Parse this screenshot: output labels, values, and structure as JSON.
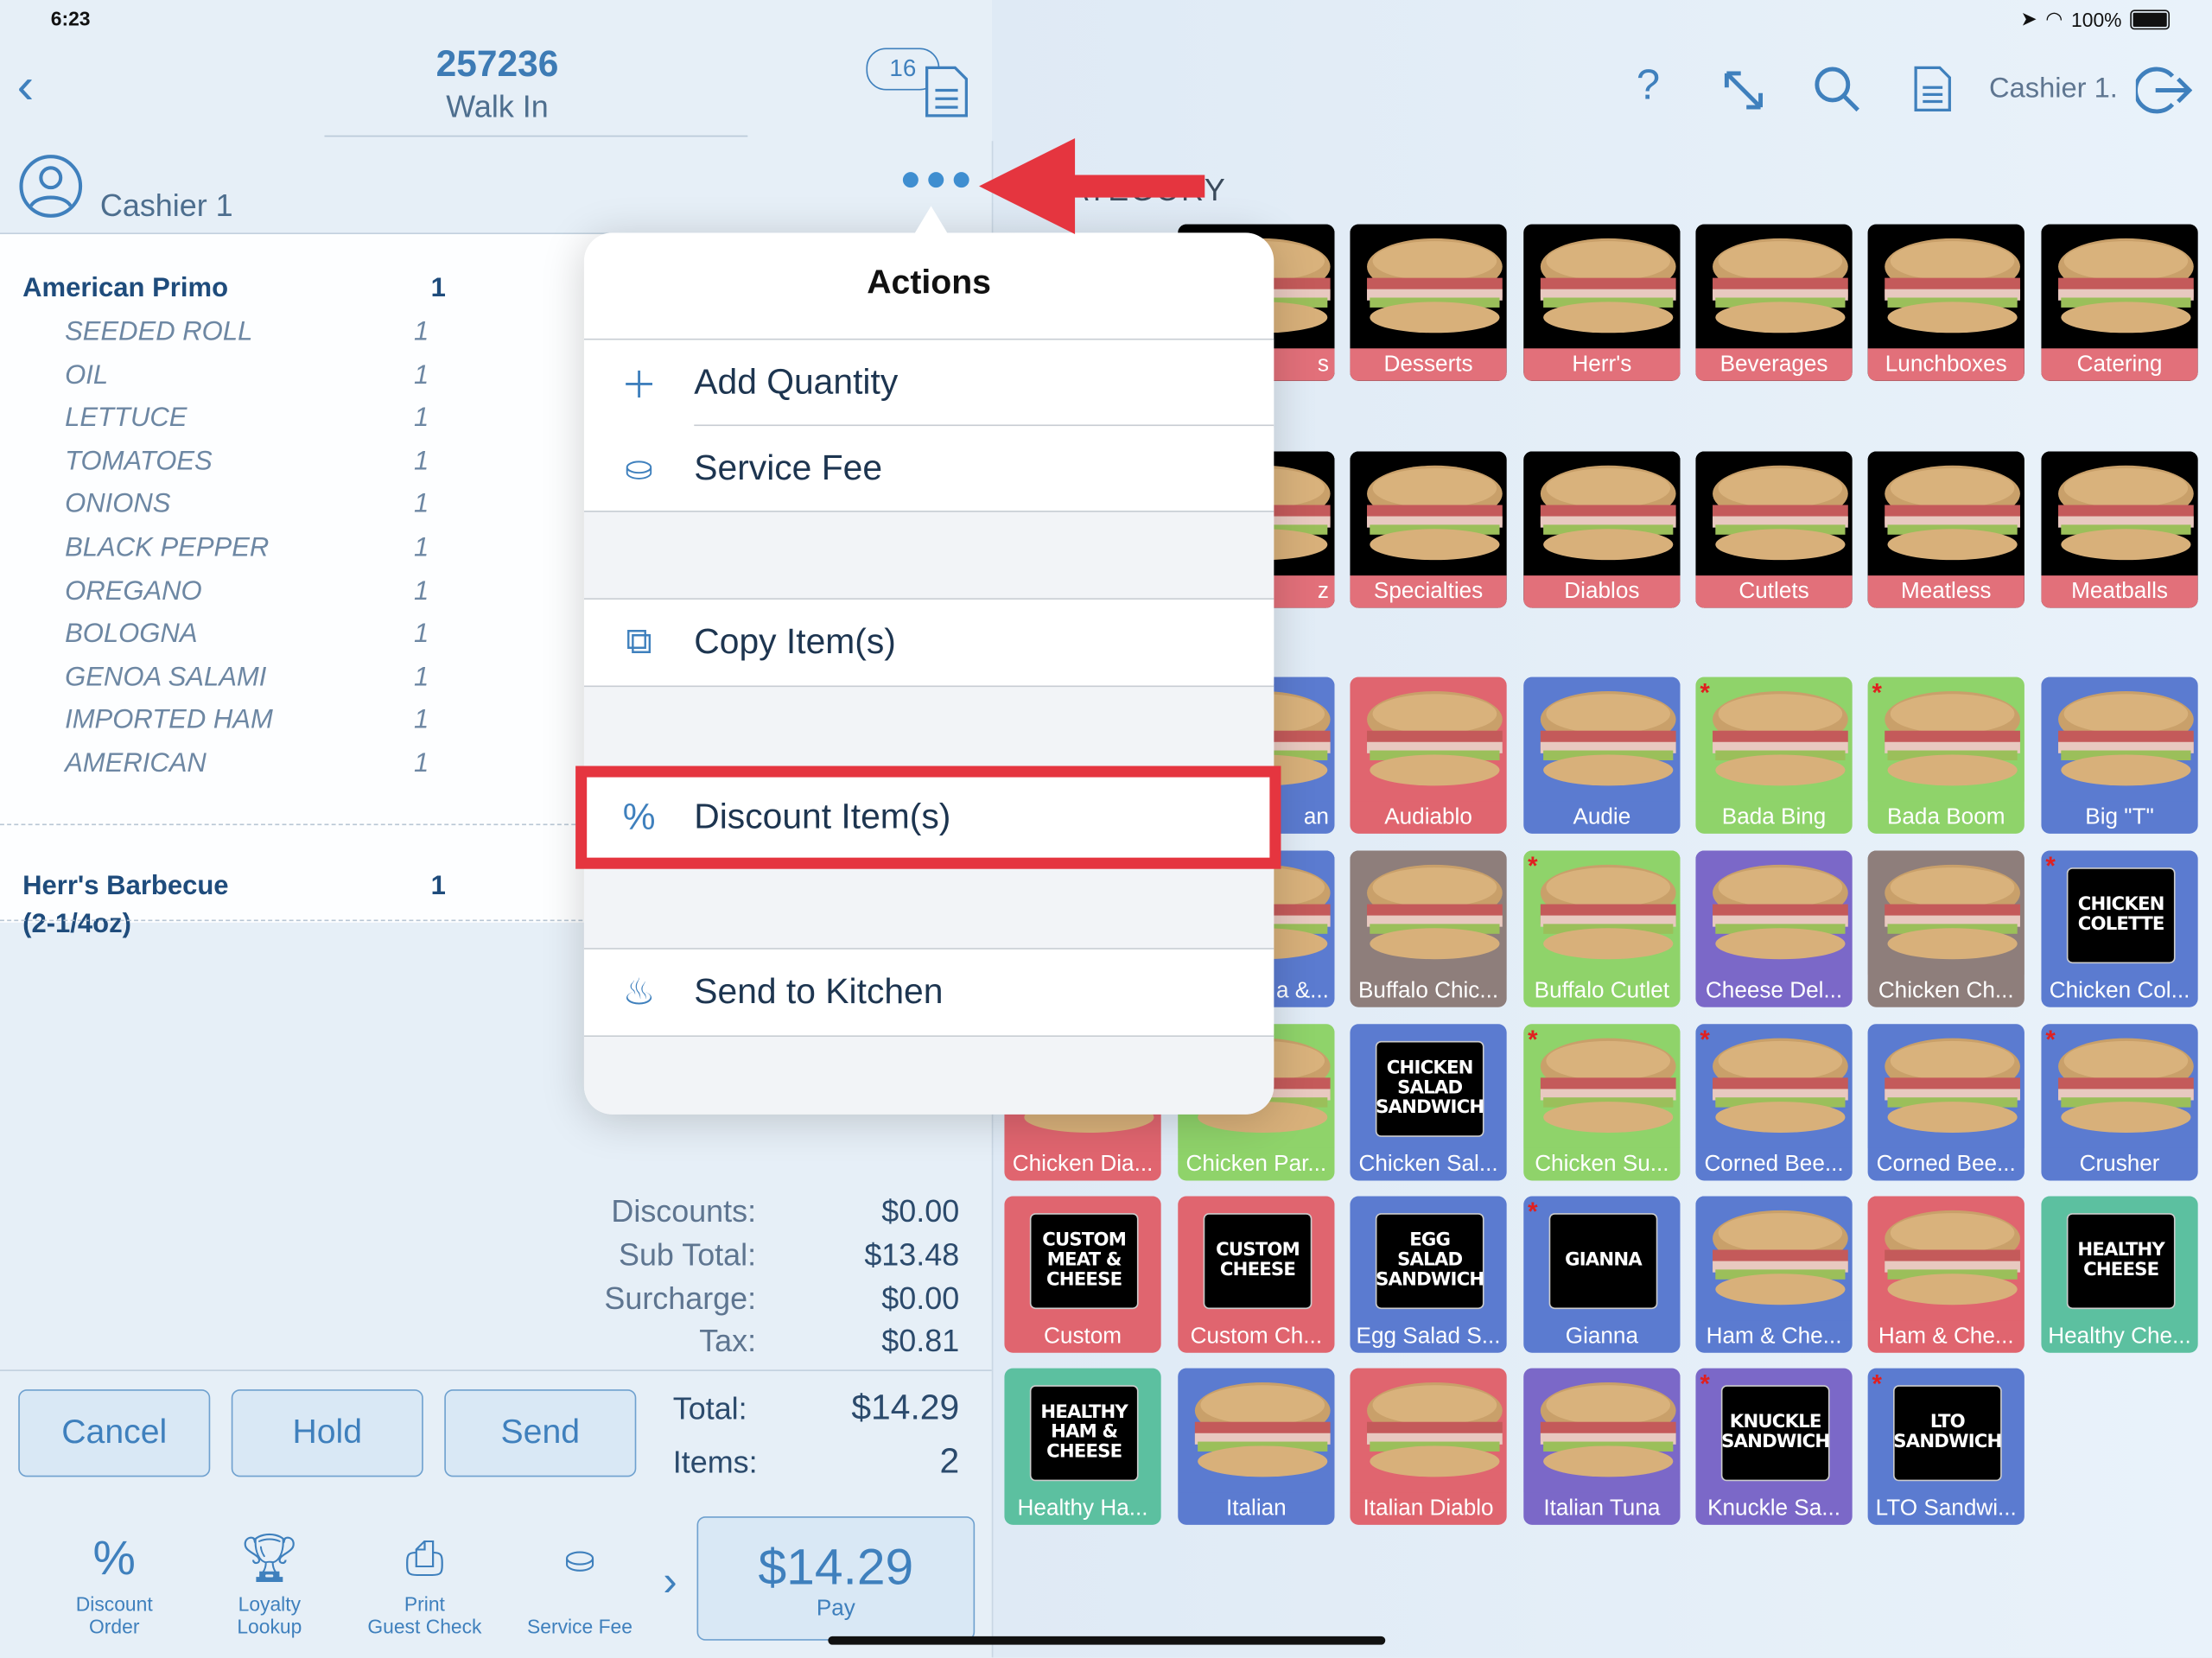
{
  "status_bar": {
    "time": "6:23",
    "battery": "100%"
  },
  "header": {
    "order_number": "257236",
    "order_type": "Walk In",
    "badge_count": "16",
    "cashier": "Cashier 1."
  },
  "cashier_row": {
    "name": "Cashier 1"
  },
  "order": {
    "items": [
      {
        "name": "American Primo",
        "qty": "1",
        "modifiers": [
          {
            "name": "SEEDED ROLL",
            "qty": "1"
          },
          {
            "name": "OIL",
            "qty": "1"
          },
          {
            "name": "LETTUCE",
            "qty": "1"
          },
          {
            "name": "TOMATOES",
            "qty": "1"
          },
          {
            "name": "ONIONS",
            "qty": "1"
          },
          {
            "name": "BLACK PEPPER",
            "qty": "1"
          },
          {
            "name": "OREGANO",
            "qty": "1"
          },
          {
            "name": "BOLOGNA",
            "qty": "1"
          },
          {
            "name": "GENOA SALAMI",
            "qty": "1"
          },
          {
            "name": "IMPORTED HAM",
            "qty": "1"
          },
          {
            "name": "AMERICAN",
            "qty": "1"
          }
        ]
      },
      {
        "name": "Herr's Barbecue",
        "name2": "(2-1/4oz)",
        "qty": "1",
        "modifiers": []
      }
    ]
  },
  "totals": {
    "discounts_label": "Discounts:",
    "discounts": "$0.00",
    "subtotal_label": "Sub Total:",
    "subtotal": "$13.48",
    "surcharge_label": "Surcharge:",
    "surcharge": "$0.00",
    "tax_label": "Tax:",
    "tax": "$0.81",
    "total_label": "Total:",
    "total": "$14.29",
    "items_label": "Items:",
    "items": "2"
  },
  "buttons": {
    "cancel": "Cancel",
    "hold": "Hold",
    "send": "Send"
  },
  "toolbar": {
    "discount_order": "Discount\nOrder",
    "loyalty_lookup": "Loyalty\nLookup",
    "print_guest_check": "Print\nGuest Check",
    "service_fee": "Service Fee",
    "pay_amount": "$14.29",
    "pay_label": "Pay"
  },
  "category_label": "CATEGORY",
  "categories": [
    [
      {
        "label": "",
        "hidden": true
      },
      {
        "label": "s"
      },
      {
        "label": "Desserts"
      },
      {
        "label": "Herr's"
      },
      {
        "label": "Beverages"
      },
      {
        "label": "Lunchboxes"
      },
      {
        "label": "Catering"
      }
    ],
    [
      {
        "label": "",
        "hidden": true
      },
      {
        "label": "z"
      },
      {
        "label": "Specialties"
      },
      {
        "label": "Diablos"
      },
      {
        "label": "Cutlets"
      },
      {
        "label": "Meatless"
      },
      {
        "label": "Meatballs"
      }
    ]
  ],
  "items": [
    [
      {
        "label": "",
        "hidden": true
      },
      {
        "label": "an",
        "color": "#5b7bd0",
        "partial": true
      },
      {
        "label": "Audiablo",
        "color": "#e0656f"
      },
      {
        "label": "Audie",
        "color": "#5b7bd0"
      },
      {
        "label": "Bada Bing",
        "color": "#8fd36a",
        "star": true
      },
      {
        "label": "Bada Boom",
        "color": "#8fd36a",
        "star": true
      },
      {
        "label": "Big \"T\"",
        "color": "#5b7bd0"
      }
    ],
    [
      {
        "label": "",
        "hidden": true
      },
      {
        "label": "a &...",
        "color": "#5b7bd0",
        "partial": true
      },
      {
        "label": "Buffalo Chic...",
        "color": "#8e7e7b"
      },
      {
        "label": "Buffalo Cutlet",
        "color": "#8fd36a",
        "star": true
      },
      {
        "label": "Cheese Del...",
        "color": "#7b68c8"
      },
      {
        "label": "Chicken Ch...",
        "color": "#8e7e7b"
      },
      {
        "label": "Chicken Col...",
        "color": "#5b7bd0",
        "star": true,
        "logo": "CHICKEN\nCOLETTE"
      }
    ],
    [
      {
        "label": "Chicken Dia...",
        "color": "#e0656f"
      },
      {
        "label": "Chicken Par...",
        "color": "#8fd36a"
      },
      {
        "label": "Chicken Sal...",
        "color": "#5b7bd0",
        "logo": "CHICKEN\nSALAD\nSANDWICH"
      },
      {
        "label": "Chicken Su...",
        "color": "#8fd36a",
        "star": true
      },
      {
        "label": "Corned Bee...",
        "color": "#5b7bd0",
        "star": true
      },
      {
        "label": "Corned Bee...",
        "color": "#5b7bd0"
      },
      {
        "label": "Crusher",
        "color": "#5b7bd0",
        "star": true
      }
    ],
    [
      {
        "label": "Custom",
        "color": "#e0656f",
        "logo": "CUSTOM\nMEAT &\nCHEESE"
      },
      {
        "label": "Custom Ch...",
        "color": "#e0656f",
        "logo": "CUSTOM\nCHEESE"
      },
      {
        "label": "Egg Salad S...",
        "color": "#5b7bd0",
        "logo": "EGG SALAD\nSANDWICH"
      },
      {
        "label": "Gianna",
        "color": "#5b7bd0",
        "star": true,
        "logo": "GIANNA"
      },
      {
        "label": "Ham & Che...",
        "color": "#5b7bd0"
      },
      {
        "label": "Ham & Che...",
        "color": "#e0656f"
      },
      {
        "label": "Healthy Che...",
        "color": "#5cc0a0",
        "logo": "HEALTHY\nCHEESE"
      }
    ],
    [
      {
        "label": "Healthy Ha...",
        "color": "#5cc0a0",
        "logo": "HEALTHY\nHAM &\nCHEESE"
      },
      {
        "label": "Italian",
        "color": "#5b7bd0"
      },
      {
        "label": "Italian Diablo",
        "color": "#e0656f"
      },
      {
        "label": "Italian Tuna",
        "color": "#7b68c8"
      },
      {
        "label": "Knuckle Sa...",
        "color": "#7b68c8",
        "star": true,
        "logo": "KNUCKLE\nSANDWICH"
      },
      {
        "label": "LTO Sandwi...",
        "color": "#5b7bd0",
        "star": true,
        "logo": "LTO\nSANDWICH"
      }
    ]
  ],
  "actions_popover": {
    "title": "Actions",
    "add_quantity": "Add Quantity",
    "service_fee": "Service Fee",
    "copy_items": "Copy Item(s)",
    "discount_items": "Discount Item(s)",
    "send_to_kitchen": "Send to Kitchen"
  },
  "colors": {
    "accent": "#3f80bd",
    "annotation_red": "#e5353f",
    "category_band": "#e2707a"
  }
}
